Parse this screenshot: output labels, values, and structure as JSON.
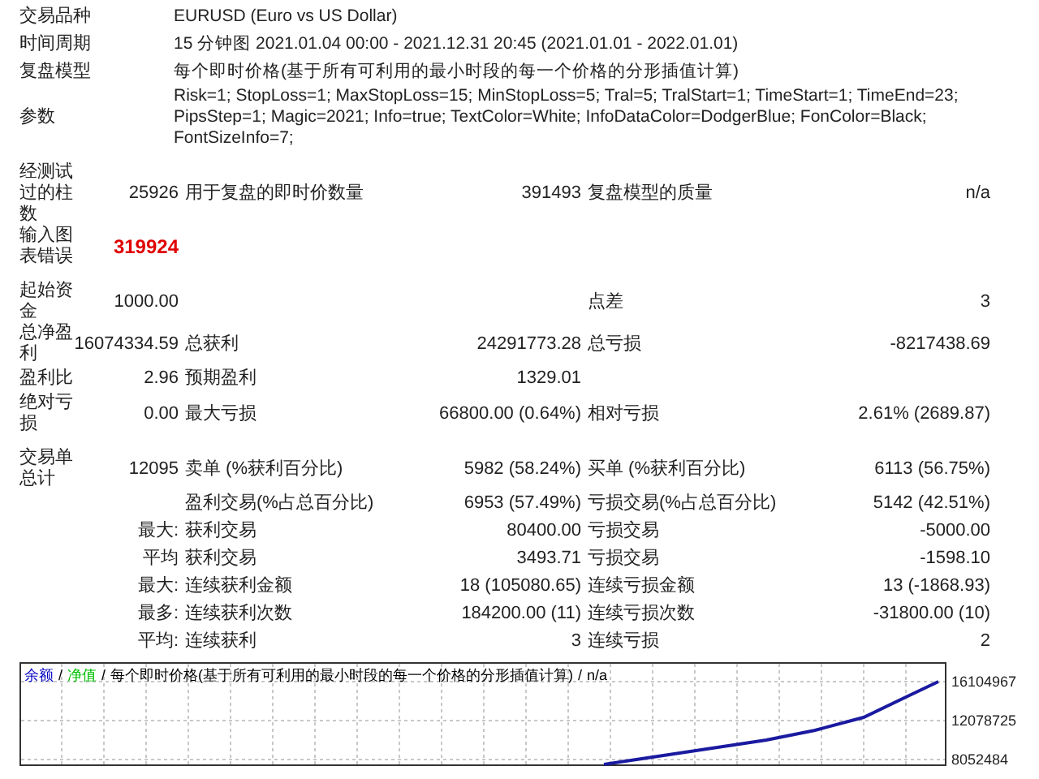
{
  "header_rows": [
    {
      "label": "交易品种",
      "value": "EURUSD (Euro vs US Dollar)"
    },
    {
      "label": "时间周期",
      "value": "15 分钟图 2021.01.04 00:00 - 2021.12.31 20:45 (2021.01.01 - 2022.01.01)"
    },
    {
      "label": "复盘模型",
      "value": "每个即时价格(基于所有可利用的最小时段的每一个价格的分形插值计算)"
    },
    {
      "label": "参数",
      "value": "Risk=1; StopLoss=1; MaxStopLoss=15; MinStopLoss=5; Tral=5; TralStart=1; TimeStart=1; TimeEnd=23; PipsStep=1; Magic=2021; Info=true; TextColor=White; InfoDataColor=DodgerBlue; FonColor=Black; FontSizeInfo=7;"
    }
  ],
  "sections": [
    {
      "rows": [
        {
          "label": "经测试过的柱数",
          "value": "25926",
          "label_2": "用于复盘的即时价数量",
          "value_2": "391493",
          "label_3": "复盘模型的质量",
          "value_3": "n/a"
        },
        {
          "label": "输入图表错误",
          "value": "319924",
          "kind": "error"
        }
      ]
    },
    {
      "rows": [
        {
          "label": "起始资金",
          "value": "1000.00",
          "label_3": "点差",
          "value_3": "3"
        },
        {
          "label": "总净盈利",
          "value": "16074334.59",
          "label_2": "总获利",
          "value_2": "24291773.28",
          "label_3": "总亏损",
          "value_3": "-8217438.69"
        },
        {
          "label": "盈利比",
          "value": "2.96",
          "label_2": "预期盈利",
          "value_2": "1329.01"
        },
        {
          "label": "绝对亏损",
          "value": "0.00",
          "label_2": "最大亏损",
          "value_2": "66800.00 (0.64%)",
          "label_3": "相对亏损",
          "value_3": "2.61% (2689.87)"
        }
      ]
    },
    {
      "rows": [
        {
          "label": "交易单总计",
          "value": "12095",
          "label_2": "卖单 (%获利百分比)",
          "value_2": "5982 (58.24%)",
          "label_3": "买单 (%获利百分比)",
          "value_3": "6113 (56.75%)"
        },
        {
          "label_2": "盈利交易(%占总百分比)",
          "value_2": "6953 (57.49%)",
          "label_3": "亏损交易(%占总百分比)",
          "value_3": "5142 (42.51%)"
        },
        {
          "value": "最大:",
          "label_2": "获利交易",
          "value_2": "80400.00",
          "label_3": "亏损交易",
          "value_3": "-5000.00"
        },
        {
          "value": "平均",
          "label_2": "获利交易",
          "value_2": "3493.71",
          "label_3": "亏损交易",
          "value_3": "-1598.10"
        },
        {
          "value": "最大:",
          "label_2": "连续获利金额",
          "value_2": "18 (105080.65)",
          "label_3": "连续亏损金额",
          "value_3": "13 (-1868.93)"
        },
        {
          "value": "最多:",
          "label_2": "连续获利次数",
          "value_2": "184200.00 (11)",
          "label_3": "连续亏损次数",
          "value_3": "-31800.00 (10)"
        },
        {
          "value": "平均:",
          "label_2": "连续获利",
          "value_2": "3",
          "label_3": "连续亏损",
          "value_3": "2"
        }
      ]
    }
  ],
  "chart": {
    "legend": [
      {
        "text": "余额",
        "color": "#0000c0"
      },
      {
        "text": "/",
        "color": "#000000"
      },
      {
        "text": "净值",
        "color": "#00c000"
      },
      {
        "text": "/",
        "color": "#000000"
      },
      {
        "text": "每个即时价格(基于所有可利用的最小时段的每一个价格的分形插值计算)",
        "color": "#000000"
      },
      {
        "text": "/",
        "color": "#000000"
      },
      {
        "text": "n/a",
        "color": "#000000"
      }
    ],
    "y_labels": [
      "16104967",
      "12078725",
      "8052484"
    ]
  }
}
